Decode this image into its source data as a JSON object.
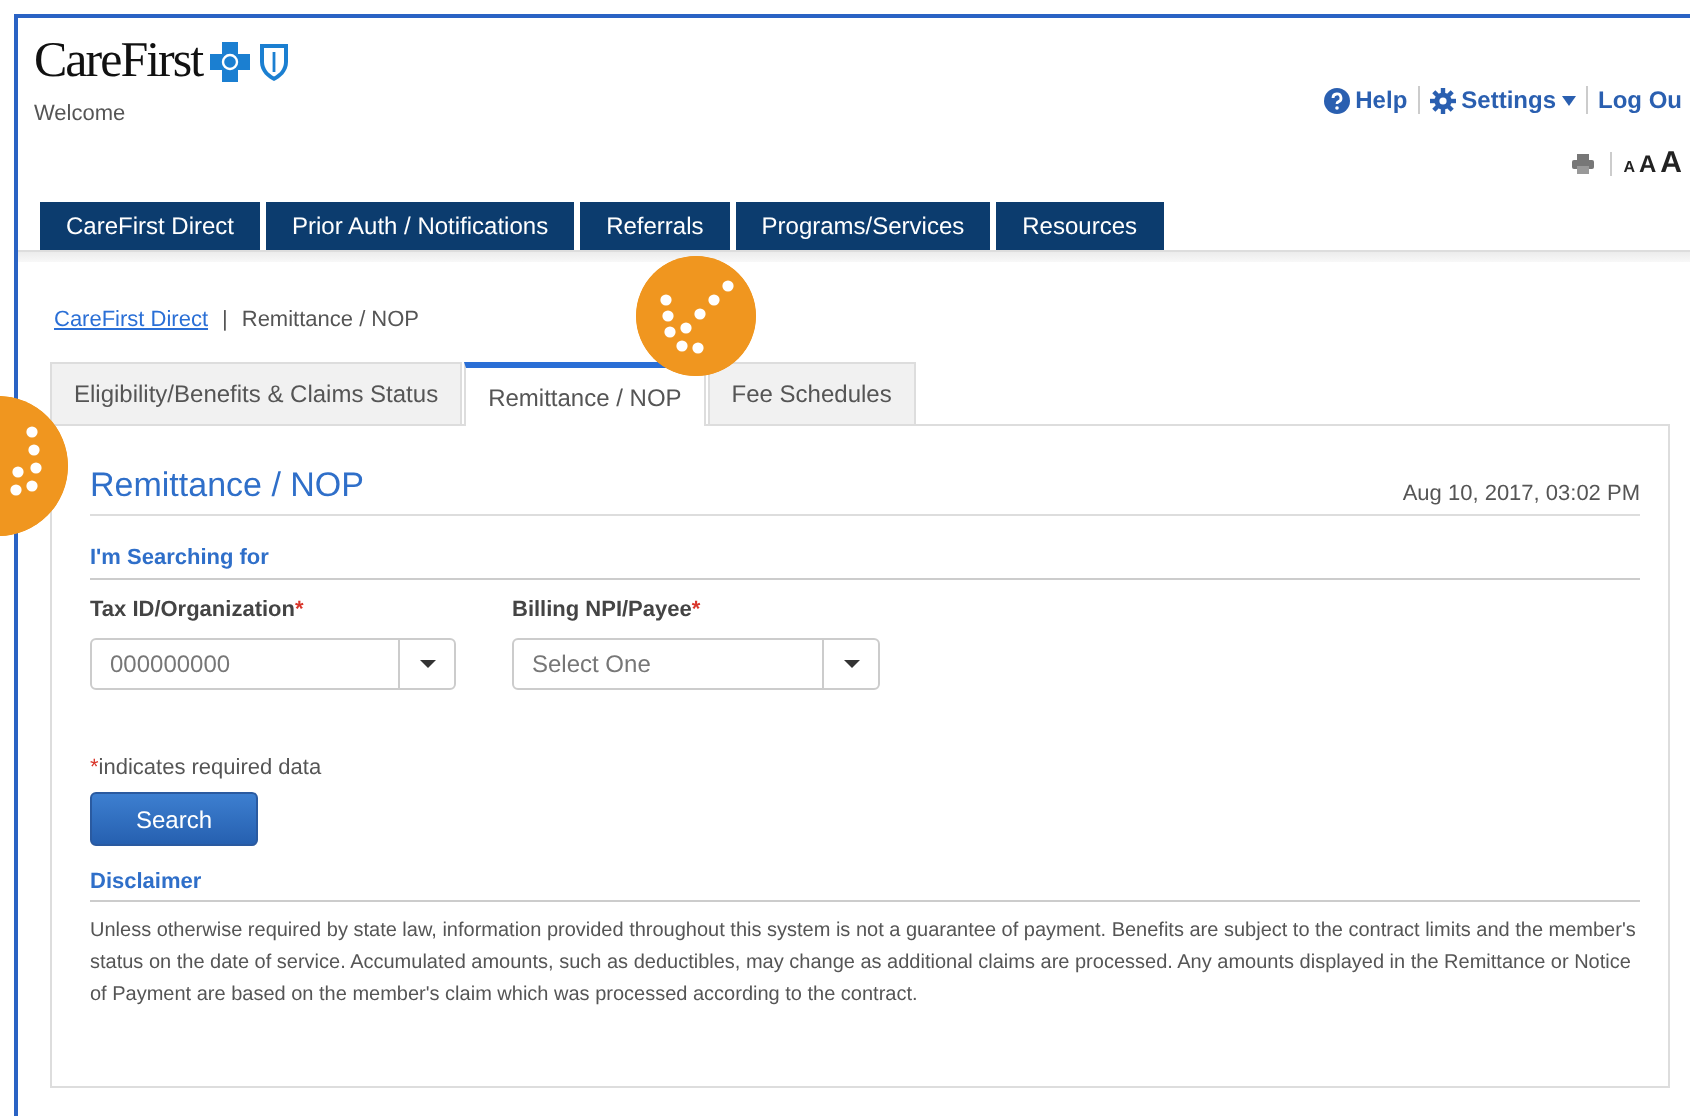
{
  "logo": {
    "text": "CareFirst"
  },
  "welcome": "Welcome",
  "utility_links": [
    {
      "label": "Help",
      "kind": "help"
    },
    {
      "label": "Settings",
      "kind": "settings"
    },
    {
      "label": "Log Ou",
      "kind": "plain"
    }
  ],
  "font_sizes": [
    "A",
    "A",
    "A"
  ],
  "nav_tabs": [
    "CareFirst Direct",
    "Prior Auth / Notifications",
    "Referrals",
    "Programs/Services",
    "Resources"
  ],
  "breadcrumb": {
    "link": "CareFirst Direct",
    "separator": "|",
    "current": "Remittance / NOP"
  },
  "tabs": [
    {
      "label": "Eligibility/Benefits & Claims Status",
      "selected": false
    },
    {
      "label": "Remittance / NOP",
      "selected": true
    },
    {
      "label": "Fee Schedules",
      "selected": false
    }
  ],
  "page_title": "Remittance / NOP",
  "timestamp": "Aug 10, 2017, 03:02 PM",
  "section_title": "I'm Searching for",
  "fields": [
    {
      "label": "Tax ID/Organization",
      "required_mark": "*",
      "value": "000000000"
    },
    {
      "label": "Billing NPI/Payee",
      "required_mark": "*",
      "value": "Select One"
    }
  ],
  "required_note": {
    "mark": "*",
    "text": "indicates required data"
  },
  "search_button": "Search",
  "disclaimer": {
    "title": "Disclaimer",
    "text": "Unless otherwise required by state law, information provided throughout this system is not a guarantee of payment. Benefits are subject to the contract limits and the member's status on the date of service. Accumulated amounts, such as deductibles, may change as additional claims are processed. Any amounts displayed in the Remittance or Notice of Payment are based on the member's claim which was processed according to the contract."
  }
}
